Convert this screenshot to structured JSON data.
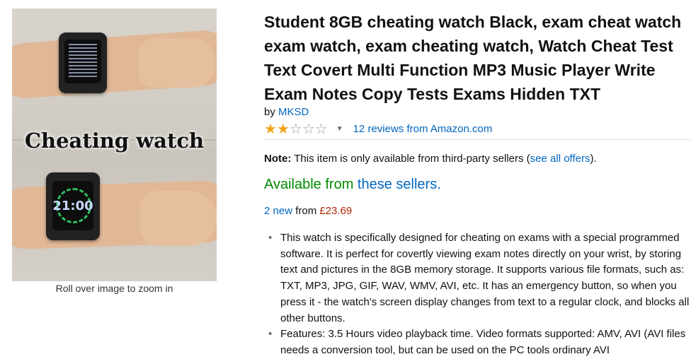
{
  "image": {
    "overlay_text": "Cheating watch",
    "watch_time": "21:00",
    "zoom_hint": "Roll over image to zoom in"
  },
  "product": {
    "title": "Student 8GB cheating watch Black, exam cheat watch exam watch, exam cheating watch, Watch Cheat Test Text Covert Multi Function MP3 Music Player Write Exam Notes Copy Tests Exams Hidden TXT",
    "by_prefix": "by",
    "brand": "MKSD",
    "rating": {
      "stars_filled": 2,
      "stars_total": 5,
      "reviews_link": "12 reviews from Amazon.com"
    },
    "note": {
      "label": "Note:",
      "text_before": "This item is only available from third-party sellers (",
      "link": "see all offers",
      "text_after": ")."
    },
    "availability": {
      "prefix": "Available from",
      "link": "these sellers."
    },
    "offers": {
      "count_link": "2 new",
      "middle": "from",
      "price": "£23.69"
    },
    "bullets": [
      "This watch is specifically designed for cheating on exams with a special programmed software. It is perfect for covertly viewing exam notes directly on your wrist, by storing text and pictures in the 8GB memory storage. It supports various file formats, such as: TXT, MP3, JPG, GIF, WAV, WMV, AVI, etc. It has an emergency button, so when you press it - the watch's screen display changes from text to a regular clock, and blocks all other buttons.",
      "Features: 3.5 Hours video playback time. Video formats supported: AMV, AVI (AVI files needs a conversion tool, but can be used on the PC tools ordinary AVI"
    ]
  },
  "colors": {
    "link": "#0066c0",
    "availability_green": "#008a00",
    "price_red": "#b12704",
    "star_gold": "#f0a31a"
  }
}
